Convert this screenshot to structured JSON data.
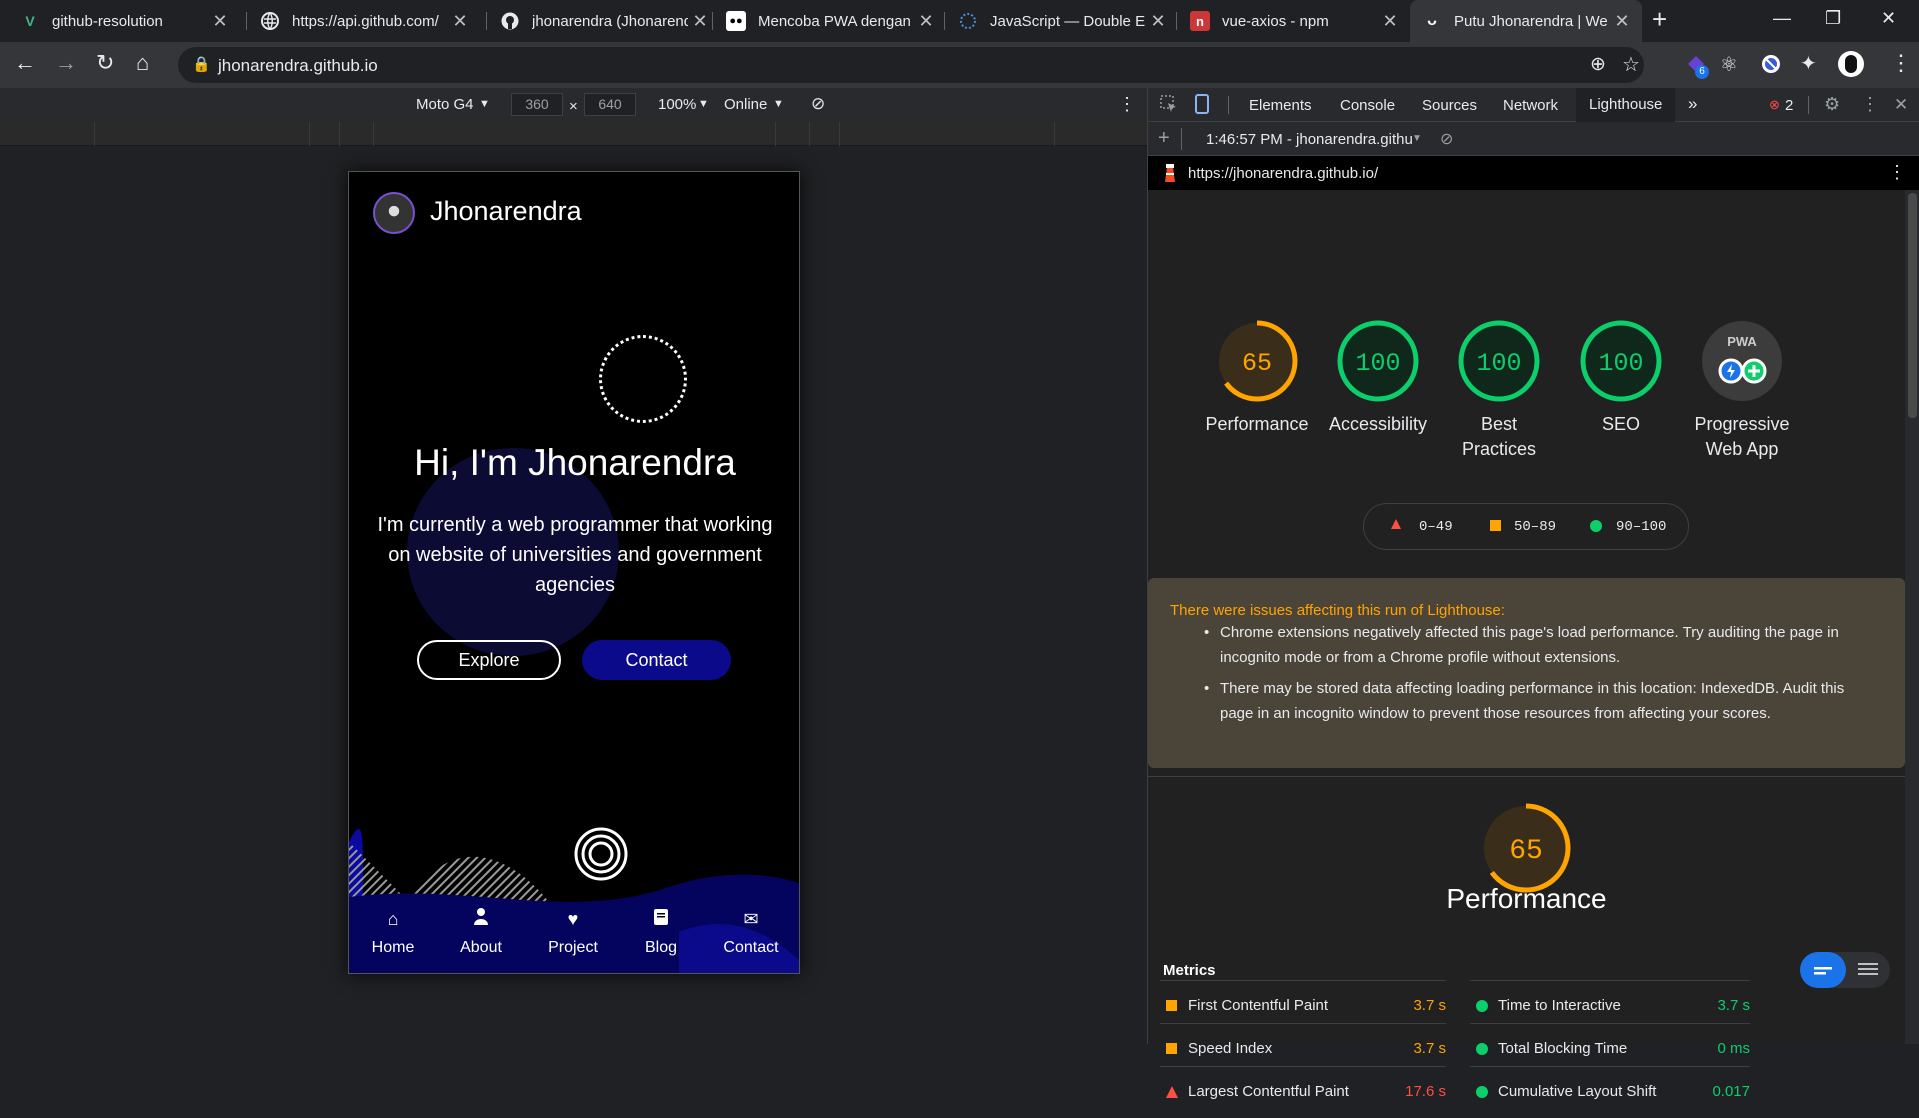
{
  "browser": {
    "tabs": [
      {
        "title": "github-resolution",
        "icon": "vue-icon",
        "color": "#41b883"
      },
      {
        "title": "https://api.github.com/",
        "icon": "globe-icon",
        "color": "#e8eaed"
      },
      {
        "title": "jhonarendra (Jhonarendra",
        "icon": "github-icon",
        "color": "#e8eaed"
      },
      {
        "title": "Mencoba PWA dengan",
        "icon": "medium-icon",
        "color": "#ffffff"
      },
      {
        "title": "JavaScript — Double E",
        "icon": "loader-icon",
        "color": "#4a90d9"
      },
      {
        "title": "vue-axios - npm",
        "icon": "npm-icon",
        "color": "#cb3837"
      },
      {
        "title": "Putu Jhonarendra | We",
        "icon": "site-icon",
        "color": "#ffffff"
      }
    ],
    "active_tab": 6,
    "url": "jhonarendra.github.io",
    "extension_badge": "6"
  },
  "device_toolbar": {
    "device": "Moto G4",
    "width": "360",
    "height": "640",
    "zoom": "100%",
    "network": "Online"
  },
  "page": {
    "brand": "Jhonarendra",
    "heading": "Hi, I'm Jhonarendra",
    "intro": "I'm currently a web programmer that working on website of universities and government agencies",
    "explore": "Explore",
    "contact": "Contact",
    "nav": [
      {
        "label": "Home",
        "icon": "home-icon"
      },
      {
        "label": "About",
        "icon": "user-icon"
      },
      {
        "label": "Project",
        "icon": "heart-icon"
      },
      {
        "label": "Blog",
        "icon": "book-icon"
      },
      {
        "label": "Contact",
        "icon": "envelope-icon"
      }
    ]
  },
  "devtools": {
    "tabs": [
      "Elements",
      "Console",
      "Sources",
      "Network",
      "Lighthouse"
    ],
    "active_tab": "Lighthouse",
    "error_count": "2",
    "report_selector": "1:46:57 PM - jhonarendra.githu",
    "report_url": "https://jhonarendra.github.io/"
  },
  "lighthouse": {
    "scores": [
      {
        "label": "Performance",
        "value": "65",
        "fraction": 0.65,
        "color": "#ffa400"
      },
      {
        "label": "Accessibility",
        "value": "100",
        "fraction": 1.0,
        "color": "#0cce6b"
      },
      {
        "label": "Best Practices",
        "value": "100",
        "fraction": 1.0,
        "color": "#0cce6b"
      },
      {
        "label": "SEO",
        "value": "100",
        "fraction": 1.0,
        "color": "#0cce6b"
      }
    ],
    "pwa": {
      "label": "Progressive Web App",
      "badge": "PWA"
    },
    "legend": [
      {
        "range": "0–49",
        "color": "#ff4e42"
      },
      {
        "range": "50–89",
        "color": "#ffa400"
      },
      {
        "range": "90–100",
        "color": "#0cce6b"
      }
    ],
    "warning_title": "There were issues affecting this run of Lighthouse:",
    "warnings": [
      "Chrome extensions negatively affected this page's load performance. Try auditing the page in incognito mode or from a Chrome profile without extensions.",
      "There may be stored data affecting loading performance in this location: IndexedDB. Audit this page in an incognito window to prevent those resources from affecting your scores."
    ],
    "performance_score": "65",
    "performance_fraction": 0.65,
    "performance_title": "Performance",
    "metrics_header": "Metrics",
    "metrics": [
      {
        "name": "First Contentful Paint",
        "value": "3.7 s",
        "status": "average"
      },
      {
        "name": "Time to Interactive",
        "value": "3.7 s",
        "status": "pass"
      },
      {
        "name": "Speed Index",
        "value": "3.7 s",
        "status": "average"
      },
      {
        "name": "Total Blocking Time",
        "value": "0 ms",
        "status": "pass"
      },
      {
        "name": "Largest Contentful Paint",
        "value": "17.6 s",
        "status": "fail"
      },
      {
        "name": "Cumulative Layout Shift",
        "value": "0.017",
        "status": "pass"
      }
    ],
    "status_colors": {
      "pass": "#0cce6b",
      "average": "#ffa400",
      "fail": "#ff4e42"
    }
  }
}
